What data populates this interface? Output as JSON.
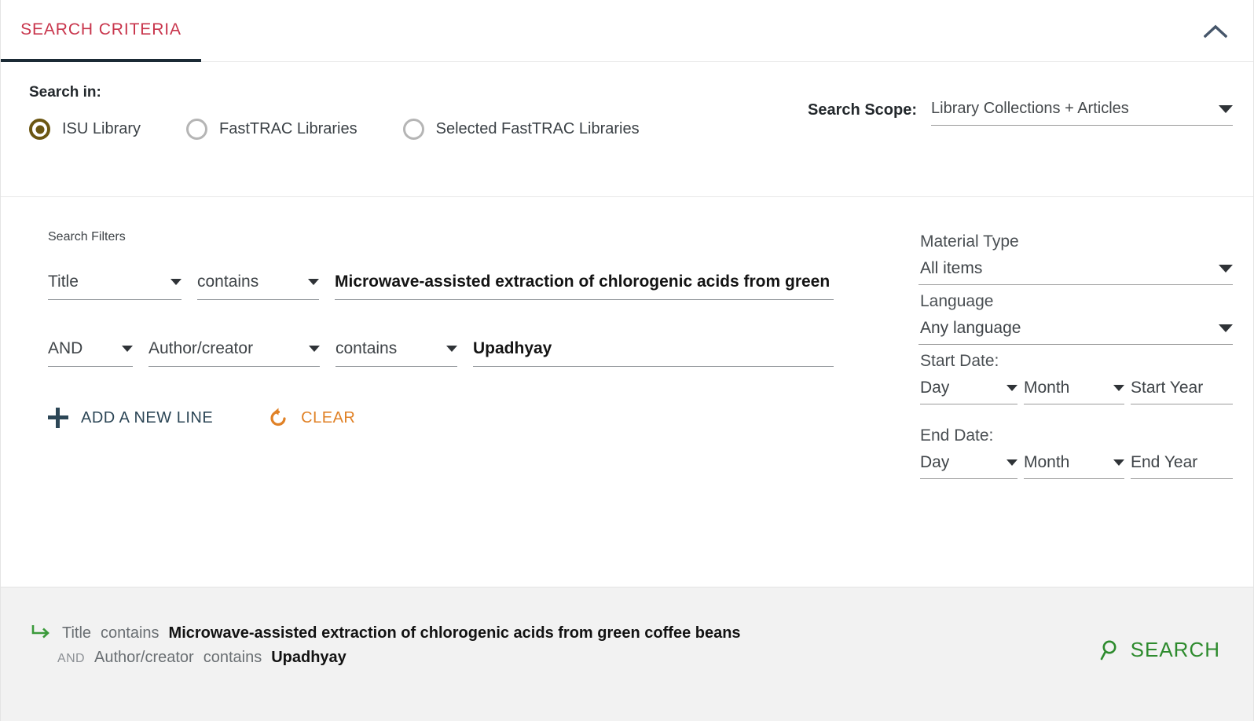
{
  "header": {
    "tab_label": "SEARCH CRITERIA",
    "collapse_icon": "chevron-up-icon",
    "accent_color": "#c8344b",
    "underline_color": "#1b2a35"
  },
  "search_in": {
    "label": "Search in:",
    "options": [
      {
        "label": "ISU Library",
        "selected": true
      },
      {
        "label": "FastTRAC Libraries",
        "selected": false
      },
      {
        "label": "Selected FastTRAC Libraries",
        "selected": false
      }
    ],
    "selected_color": "#6b5612"
  },
  "search_scope": {
    "label": "Search Scope:",
    "value": "Library Collections + Articles"
  },
  "filters": {
    "title": "Search Filters",
    "rows": [
      {
        "boolean": null,
        "field": "Title",
        "operator": "contains",
        "value": "Microwave-assisted extraction of chlorogenic acids from green"
      },
      {
        "boolean": "AND",
        "field": "Author/creator",
        "operator": "contains",
        "value": "Upadhyay"
      }
    ],
    "add_line_label": "ADD A NEW LINE",
    "add_line_icon": "plus-icon",
    "clear_label": "CLEAR",
    "clear_icon": "reset-icon",
    "add_line_color": "#2c4656",
    "clear_color": "#e08126"
  },
  "refine": {
    "material_type_label": "Material Type",
    "material_type_value": "All items",
    "language_label": "Language",
    "language_value": "Any language",
    "start_date_label": "Start Date:",
    "start_day": "Day",
    "start_month": "Month",
    "start_year_placeholder": "Start Year",
    "end_date_label": "End Date:",
    "end_day": "Day",
    "end_month": "Month",
    "end_year_placeholder": "End Year"
  },
  "summary": {
    "arrow_icon": "arrow-return-icon",
    "arrow_color": "#3b9a3b",
    "line1": {
      "field": "Title",
      "operator": "contains",
      "value": "Microwave-assisted extraction of chlorogenic acids from green coffee beans"
    },
    "line2": {
      "boolean": "AND",
      "field": "Author/creator",
      "operator": "contains",
      "value": "Upadhyay"
    }
  },
  "search_button": {
    "label": "SEARCH",
    "icon": "search-icon",
    "color": "#2e8b2e"
  }
}
